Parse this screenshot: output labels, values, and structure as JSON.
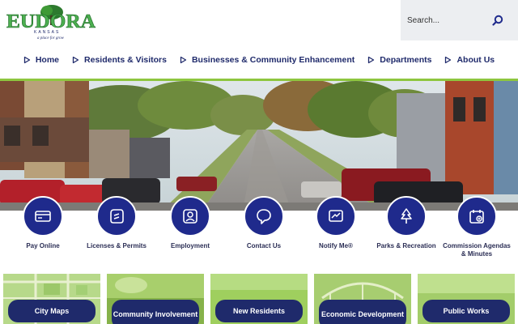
{
  "header": {
    "logo_text": "EUDORA",
    "logo_subtext": "KANSAS",
    "logo_tagline": "a place for grow"
  },
  "search": {
    "placeholder": "Search..."
  },
  "nav": {
    "items": [
      {
        "label": "Home"
      },
      {
        "label": "Residents & Visitors"
      },
      {
        "label": "Businesses & Community Enhancement"
      },
      {
        "label": "Departments"
      },
      {
        "label": "About Us"
      }
    ]
  },
  "quick_links": [
    {
      "label": "Pay Online",
      "icon": "credit-card-icon"
    },
    {
      "label": "Licenses & Permits",
      "icon": "license-icon"
    },
    {
      "label": "Employment",
      "icon": "id-badge-icon"
    },
    {
      "label": "Contact Us",
      "icon": "chat-bubble-icon"
    },
    {
      "label": "Notify Me®",
      "icon": "notify-icon"
    },
    {
      "label": "Parks & Recreation",
      "icon": "tree-icon"
    },
    {
      "label": "Commission Agendas & Minutes",
      "icon": "calendar-icon"
    }
  ],
  "tiles": [
    {
      "label": "City Maps"
    },
    {
      "label": "Community Involvement"
    },
    {
      "label": "New Residents"
    },
    {
      "label": "Economic Development"
    },
    {
      "label": "Public Works"
    }
  ],
  "colors": {
    "brand_navy": "#1f2a6b",
    "icon_circle": "#1f2a8c",
    "accent_green": "#8ec63f"
  }
}
